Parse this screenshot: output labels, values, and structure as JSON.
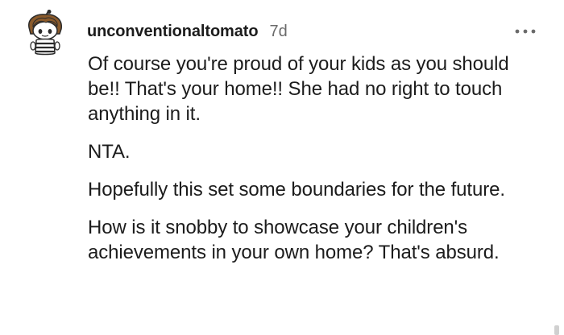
{
  "comment": {
    "author": "unconventionaltomato",
    "time_ago": "7d",
    "paragraphs": [
      "Of course you're proud of your kids as you should be!! That's your home!! She had no right to touch anything in it.",
      "NTA.",
      "Hopefully this set some boundaries for the future.",
      "How is it snobby to showcase your children's achievements in your own home? That's absurd."
    ]
  },
  "icons": {
    "avatar": "snoo-avatar",
    "overflow": "more-options-icon"
  },
  "colors": {
    "text": "#1c1c1c",
    "meta": "#6b6b6b",
    "background": "#ffffff"
  }
}
